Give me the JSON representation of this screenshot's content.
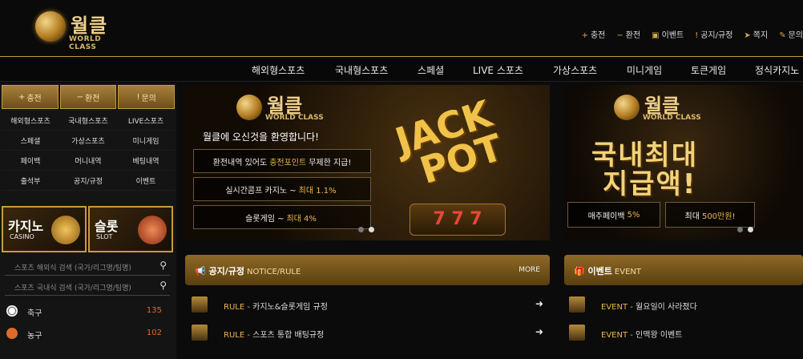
{
  "logo": {
    "korean": "월클",
    "english": "WORLD CLASS"
  },
  "top_links": [
    {
      "icon": "+",
      "label": "충전"
    },
    {
      "icon": "−",
      "label": "환전"
    },
    {
      "icon": "▣",
      "label": "이벤트"
    },
    {
      "icon": "!",
      "label": "공지/규정"
    },
    {
      "icon": "➤",
      "label": "쪽지"
    },
    {
      "icon": "✎",
      "label": "문의"
    }
  ],
  "nav": [
    "해외형스포츠",
    "국내형스포츠",
    "스페셜",
    "LIVE 스포츠",
    "가상스포츠",
    "미니게임",
    "토큰게임",
    "정식카지노"
  ],
  "side_buttons": [
    {
      "icon": "+",
      "label": "충전"
    },
    {
      "icon": "−",
      "label": "환전"
    },
    {
      "icon": "!",
      "label": "문의"
    }
  ],
  "side_grid": [
    "해외형스포츠",
    "국내형스포츠",
    "LIVE스포츠",
    "스페셜",
    "가상스포츠",
    "미니게임",
    "페이백",
    "머니내역",
    "베팅내역",
    "출석부",
    "공지/규정",
    "이벤트"
  ],
  "promo_boxes": [
    {
      "title": "카지노",
      "sub": "CASINO"
    },
    {
      "title": "슬롯",
      "sub": "SLOT"
    }
  ],
  "search": [
    {
      "placeholder": "스포츠 해외식 검색 (국가/리그명/팀명)"
    },
    {
      "placeholder": "스포츠 국내식 검색 (국가/리그명/팀명)"
    }
  ],
  "sports": [
    {
      "name": "축구",
      "count": "135",
      "color": "#eeeeee"
    },
    {
      "name": "농구",
      "count": "102",
      "color": "#e06a2a"
    }
  ],
  "banner1": {
    "logo_ko": "월클",
    "logo_en": "WORLD CLASS",
    "welcome": "월클에 오신것을 환영합니다!",
    "lines": [
      {
        "pre": "환전내역 있어도",
        "hl": "충전포인트",
        "post": "무제한 지급!"
      },
      {
        "pre": "실시간콤프 카지노 ~",
        "hl": "최대 1.1%",
        "post": ""
      },
      {
        "pre": "슬롯게임 ~",
        "hl": "최대 4%",
        "post": ""
      }
    ],
    "jackpot_line1": "JACK",
    "jackpot_line2": "POT",
    "reel": "7 7 7"
  },
  "banner2": {
    "logo_ko": "월클",
    "logo_en": "WORLD CLASS",
    "line1": "국내최대",
    "line2": "지급액!",
    "pills": [
      {
        "pre": "매주페이백",
        "hl": "5%"
      },
      {
        "pre": "최대",
        "hl": "500만원!"
      }
    ]
  },
  "notice": {
    "title": "공지/규정",
    "sub": "NOTICE/RULE",
    "more": "MORE",
    "rows": [
      {
        "tag": "RULE -",
        "text": "카지노&슬롯게임 규정"
      },
      {
        "tag": "RULE -",
        "text": "스포츠 통합 배팅규정"
      }
    ]
  },
  "event": {
    "title": "이벤트",
    "sub": "EVENT",
    "rows": [
      {
        "tag": "EVENT -",
        "text": "월요일이 사라졌다"
      },
      {
        "tag": "EVENT -",
        "text": "인맥왕 이벤트"
      }
    ]
  }
}
